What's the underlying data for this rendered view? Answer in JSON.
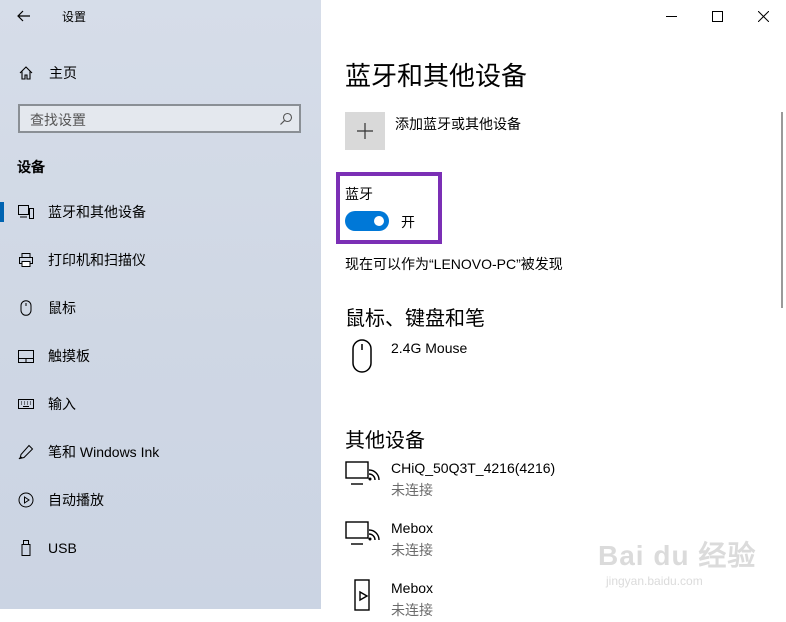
{
  "window": {
    "title": "设置",
    "icons": {
      "back": "back-arrow-icon",
      "minimize": "minimize-icon",
      "maximize": "maximize-icon",
      "close": "close-icon"
    }
  },
  "sidebar": {
    "home_label": "主页",
    "search_placeholder": "查找设置",
    "section_heading": "设备",
    "items": [
      {
        "label": "蓝牙和其他设备",
        "icon": "bluetooth-devices-icon",
        "active": true
      },
      {
        "label": "打印机和扫描仪",
        "icon": "printer-icon",
        "active": false
      },
      {
        "label": "鼠标",
        "icon": "mouse-icon",
        "active": false
      },
      {
        "label": "触摸板",
        "icon": "touchpad-icon",
        "active": false
      },
      {
        "label": "输入",
        "icon": "keyboard-icon",
        "active": false
      },
      {
        "label": "笔和 Windows Ink",
        "icon": "pen-icon",
        "active": false
      },
      {
        "label": "自动播放",
        "icon": "autoplay-icon",
        "active": false
      },
      {
        "label": "USB",
        "icon": "usb-icon",
        "active": false
      }
    ]
  },
  "main": {
    "title": "蓝牙和其他设备",
    "add_device_label": "添加蓝牙或其他设备",
    "bluetooth": {
      "label": "蓝牙",
      "state": "开",
      "on": true
    },
    "discoverable_text": "现在可以作为“LENOVO-PC”被发现",
    "groups": [
      {
        "heading": "鼠标、键盘和笔",
        "devices": [
          {
            "name": "2.4G Mouse",
            "status": "",
            "icon": "mouse-device-icon"
          }
        ]
      },
      {
        "heading": "其他设备",
        "devices": [
          {
            "name": "CHiQ_50Q3T_4216(4216)",
            "status": "未连接",
            "icon": "display-wireless-icon"
          },
          {
            "name": "Mebox",
            "status": "未连接",
            "icon": "display-wireless-icon"
          },
          {
            "name": "Mebox",
            "status": "未连接",
            "icon": "media-player-icon"
          }
        ]
      }
    ]
  },
  "colors": {
    "accent": "#0078d7",
    "highlight": "#7b2fb5",
    "sidebar_bg": "#d3dae6"
  },
  "watermark": {
    "main": "Bai du 经验",
    "sub": "jingyan.baidu.com"
  }
}
